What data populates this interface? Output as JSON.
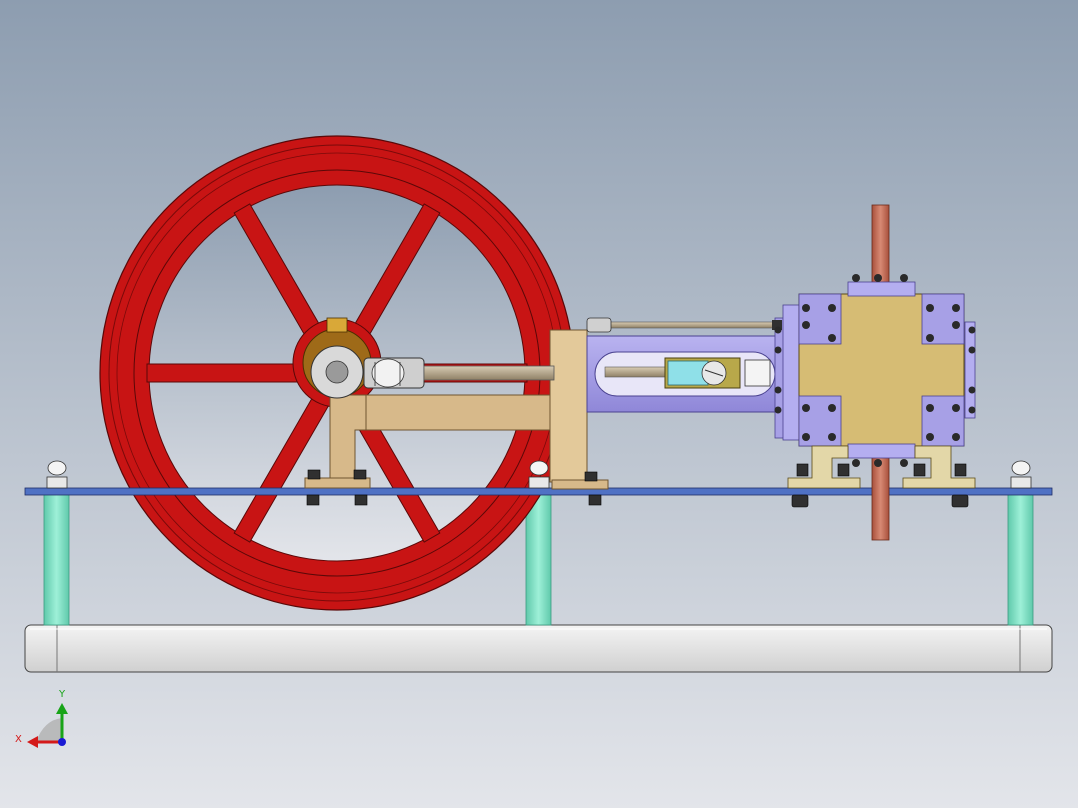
{
  "viewport": {
    "background_top": "#8d9db0",
    "background_bottom": "#e3e5ea"
  },
  "colors": {
    "flywheel": "#c81414",
    "flywheel_dark": "#7a0a0a",
    "brass": "#d7b98a",
    "brass_dark": "#9c7d4e",
    "cylinder": "#a7a0e6",
    "cylinder_dark": "#6e66b8",
    "valve_block": "#d6bc74",
    "rod": "#b9a98c",
    "pipe": "#c46a54",
    "plate": "#4f71c4",
    "post": "#7fe0c4",
    "base": "#e6e6e6",
    "bolt": "#303030"
  },
  "triad": {
    "x_label": "X",
    "y_label": "Y",
    "x_color": "#d41a1a",
    "y_color": "#18a418",
    "z_color": "#1a1ad4"
  }
}
